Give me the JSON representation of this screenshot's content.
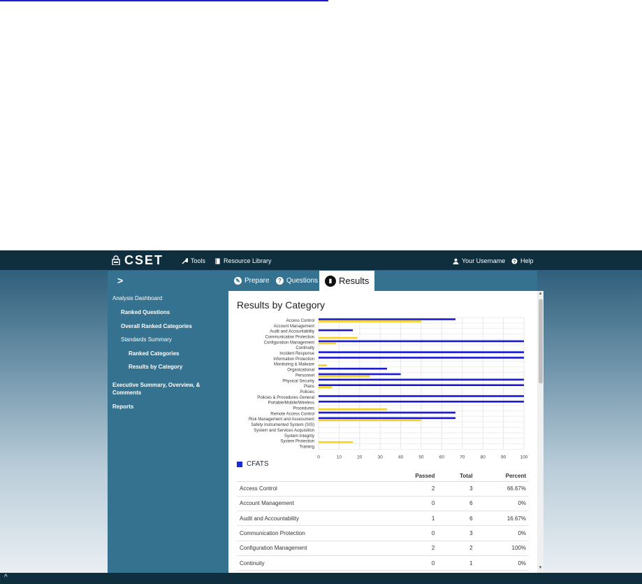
{
  "nav": {
    "logo_text": "CSET",
    "tools": "Tools",
    "resource_library": "Resource Library",
    "username": "Your Username",
    "help": "Help"
  },
  "tabs": {
    "expander": ">",
    "prepare": "Prepare",
    "questions": "Questions",
    "results": "Results"
  },
  "sidebar": {
    "items": [
      "Analysis Dashboard",
      "Ranked Questions",
      "Overall Ranked Categories",
      "Standards Summary",
      "Ranked Categories",
      "Results by Category",
      "Executive Summary, Overview, &",
      "Comments",
      "Reports"
    ]
  },
  "page": {
    "title": "Results by Category",
    "legend_label": "CFATS"
  },
  "colors": {
    "nav": "#0f2e3e",
    "panel": "#35728f",
    "series_blue": "#1a1ad6",
    "series_yellow": "#f5d21f"
  },
  "chart_data": {
    "type": "bar",
    "orientation": "horizontal",
    "categories": [
      "Access Control",
      "Account Management",
      "Audit and Accountability",
      "Communication Protection",
      "Configuration Management",
      "Continuity",
      "Incident Response",
      "Information Protection",
      "Monitoring & Malware",
      "Organizational",
      "Personnel",
      "Physical Security",
      "Plans",
      "Policies",
      "Policies & Procedures General",
      "Portable/Mobile/Wireless",
      "Procedures",
      "Remote Access Control",
      "Risk Management and Assessment",
      "Safety Instrumented System (SIS)",
      "System and Services Acquisition",
      "System Integrity",
      "System Protection",
      "Training"
    ],
    "series": [
      {
        "color": "#1a1ad6",
        "values": [
          66.67,
          0,
          16.67,
          0,
          100,
          0,
          100,
          100,
          0,
          33.33,
          40,
          100,
          100,
          0,
          100,
          100,
          0,
          66.67,
          66.67,
          0,
          0,
          0,
          0,
          0
        ]
      },
      {
        "color": "#f5d21f",
        "values": [
          50,
          0,
          0,
          19,
          8.5,
          0,
          0,
          0,
          4,
          0,
          25,
          0,
          6.5,
          0,
          0,
          0,
          33.33,
          0,
          50,
          0,
          0,
          0,
          16.67,
          0
        ]
      }
    ],
    "xlim": [
      0,
      100
    ],
    "xticks": [
      0,
      10,
      20,
      30,
      40,
      50,
      60,
      70,
      80,
      90,
      100
    ],
    "grid": true
  },
  "table": {
    "headers": [
      "",
      "Passed",
      "Total",
      "Percent"
    ],
    "rows": [
      [
        "Access Control",
        "2",
        "3",
        "66.67%"
      ],
      [
        "Account Management",
        "0",
        "6",
        "0%"
      ],
      [
        "Audit and Accountability",
        "1",
        "6",
        "16.67%"
      ],
      [
        "Communication Protection",
        "0",
        "3",
        "0%"
      ],
      [
        "Configuration Management",
        "2",
        "2",
        "100%"
      ],
      [
        "Continuity",
        "0",
        "1",
        "0%"
      ]
    ]
  }
}
